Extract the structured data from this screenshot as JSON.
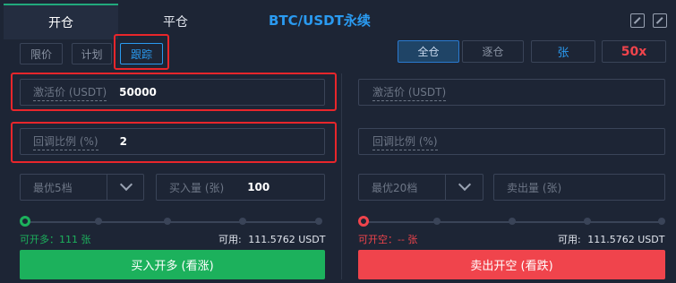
{
  "tabs": {
    "open": "开仓",
    "close": "平仓"
  },
  "title": "BTC/USDT永续",
  "order_types": [
    "限价",
    "计划",
    "跟踪"
  ],
  "margin_modes": [
    "全仓",
    "逐仓"
  ],
  "unit": "张",
  "leverage": "50x",
  "buy": {
    "activation_label": "激活价 (USDT)",
    "activation_value": "50000",
    "callback_label": "回调比例 (%)",
    "callback_value": "2",
    "price_select": "最优5档",
    "qty_label": "买入量 (张)",
    "qty_value": "100",
    "can_open_label": "可开多：",
    "can_open_value": "111 张",
    "available_label": "可用:",
    "available_value": "111.5762 USDT",
    "button": "买入开多 (看涨)",
    "slider_percent": 0
  },
  "sell": {
    "activation_label": "激活价 (USDT)",
    "callback_label": "回调比例 (%)",
    "price_select": "最优20档",
    "qty_label": "卖出量 (张)",
    "can_open_label": "可开空：",
    "can_open_value": "-- 张",
    "available_label": "可用:",
    "available_value": "111.5762 USDT",
    "button": "卖出开空 (看跌)",
    "slider_percent": 0
  },
  "colors": {
    "buy": "#1cb15c",
    "sell": "#f0444c",
    "accent": "#2a9af0",
    "highlight": "#e8262b",
    "leverage": "#f0444c"
  },
  "icons": [
    "calculator-icon",
    "percent-icon",
    "chevron-down-icon"
  ]
}
